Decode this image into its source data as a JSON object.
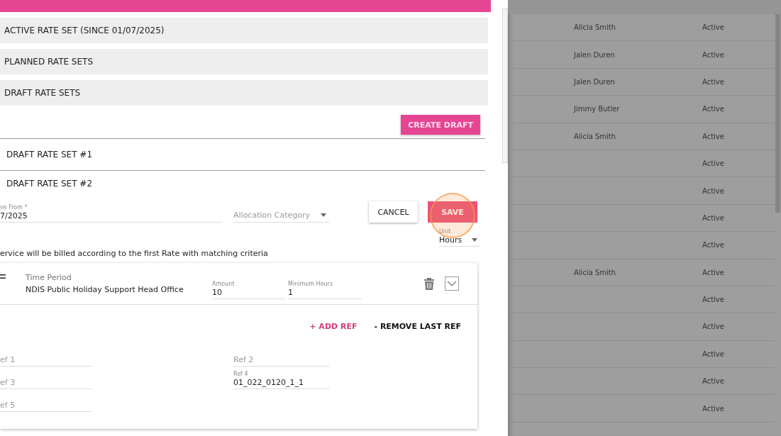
{
  "rate_sets_panel": {
    "sections": [
      {
        "label": "ACTIVE RATE SET (SINCE 01/07/2025)"
      },
      {
        "label": "PLANNED RATE SETS"
      },
      {
        "label": "DRAFT RATE SETS"
      }
    ],
    "create_draft_button": "CREATE DRAFT",
    "drafts": [
      {
        "title": "DRAFT RATE SET #1"
      },
      {
        "title": "DRAFT RATE SET #2"
      }
    ],
    "effective_from": {
      "label": "ve From *",
      "value": "7/2025"
    },
    "allocation_category": {
      "placeholder": "Allocation Category"
    },
    "cancel_button": "CANCEL",
    "save_button": "SAVE",
    "unit": {
      "label": "Unit",
      "value": "Hours"
    },
    "note": "ervice will be billed according to the first Rate with matching criteria",
    "rate_card": {
      "time_period": {
        "label": "Time Period",
        "value": "NDIS Public Holiday Support Head Office"
      },
      "amount": {
        "label": "Amount",
        "value": "10"
      },
      "minimum_hours": {
        "label": "Minimum Hours",
        "value": "1"
      },
      "add_ref_button": "+ ADD REF",
      "remove_ref_button": "- REMOVE LAST REF",
      "refs": [
        {
          "placeholder": "ef 1"
        },
        {
          "placeholder": "ef 3"
        },
        {
          "placeholder": "ef 5"
        },
        {
          "placeholder": "Ref 2"
        },
        {
          "label": "Ref 4",
          "value": "01_022_0120_1_1"
        }
      ]
    }
  },
  "background_table": {
    "rows": [
      {
        "created_by": "Alicia Smith",
        "status": "Active"
      },
      {
        "created_by": "Jalen Duren",
        "status": "Active"
      },
      {
        "created_by": "Jalen Duren",
        "status": "Active"
      },
      {
        "created_by": "Jimmy Butler",
        "status": "Active"
      },
      {
        "created_by": "Alicia Smith",
        "status": "Active"
      },
      {
        "status": "Active"
      },
      {
        "status": "Active"
      },
      {
        "status": "Active"
      },
      {
        "status": "Active"
      },
      {
        "created_by": "Alicia Smith",
        "status": "Active"
      },
      {
        "status": "Active"
      },
      {
        "status": "Active"
      },
      {
        "status": "Active"
      },
      {
        "status": "Active"
      },
      {
        "status": "Active"
      }
    ]
  }
}
